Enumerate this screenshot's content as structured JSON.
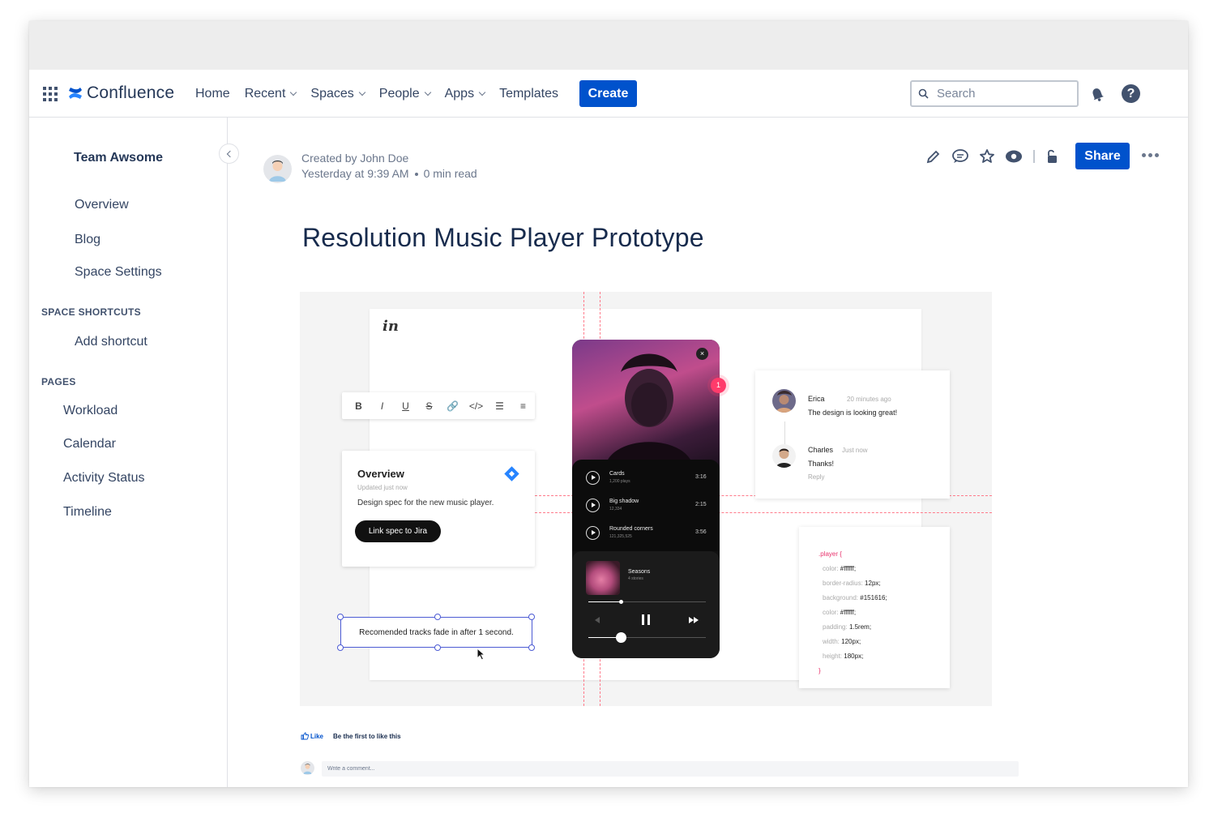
{
  "app": {
    "name": "Confluence",
    "brand_color": "#0052cc"
  },
  "topnav": {
    "items": [
      {
        "label": "Home",
        "has_dropdown": false
      },
      {
        "label": "Recent",
        "has_dropdown": true
      },
      {
        "label": "Spaces",
        "has_dropdown": true
      },
      {
        "label": "People",
        "has_dropdown": true
      },
      {
        "label": "Apps",
        "has_dropdown": true
      },
      {
        "label": "Templates",
        "has_dropdown": false
      }
    ],
    "create_label": "Create",
    "search_placeholder": "Search",
    "help_glyph": "?"
  },
  "sidebar": {
    "space_name": "Team Awsome",
    "items": [
      "Overview",
      "Blog",
      "Space Settings"
    ],
    "shortcuts_heading": "SPACE SHORTCUTS",
    "add_shortcut": "Add shortcut",
    "pages_heading": "PAGES",
    "pages": [
      "Workload",
      "Calendar",
      "Activity Status",
      "Timeline"
    ]
  },
  "page": {
    "created_by": "Created by John Doe",
    "timestamp": "Yesterday at 9:39 AM",
    "read_time": "0 min read",
    "share_label": "Share",
    "title": "Resolution Music Player Prototype"
  },
  "prototype": {
    "logo": "in",
    "rte_buttons": [
      "B",
      "I",
      "U",
      "S",
      "🔗",
      "</>",
      "☰",
      "≡"
    ],
    "overview": {
      "title": "Overview",
      "updated": "Updated just now",
      "description": "Design spec for the new music player.",
      "button": "Link spec to Jira"
    },
    "note": "Recomended tracks fade in after 1 second.",
    "close_glyph": "×",
    "tracks": [
      {
        "name": "Cards",
        "plays": "1,200 plays",
        "duration": "3:16"
      },
      {
        "name": "Big shadow",
        "plays": "12,334",
        "duration": "2:15"
      },
      {
        "name": "Rounded corners",
        "plays": "121,325,525",
        "duration": "3:56"
      }
    ],
    "now_playing": {
      "name": "Seasons",
      "sub": "4 stories"
    },
    "badge_count": "1",
    "comments": [
      {
        "name": "Erica",
        "time": "20 minutes ago",
        "text": "The design is looking great!"
      },
      {
        "name": "Charles",
        "time": "Just now",
        "text": "Thanks!",
        "reply": "Reply"
      }
    ],
    "code": {
      "selector": ".player {",
      "lines": [
        {
          "prop": "color:",
          "value": "#ffffff;"
        },
        {
          "prop": "border-radius:",
          "value": "12px;"
        },
        {
          "prop": "background:",
          "value": "#151616;"
        },
        {
          "prop": "color:",
          "value": "#ffffff;"
        },
        {
          "prop": "padding:",
          "value": "1.5rem;"
        },
        {
          "prop": "width:",
          "value": "120px;"
        },
        {
          "prop": "height:",
          "value": "180px;"
        }
      ],
      "close": "}"
    }
  },
  "footer": {
    "like_label": "Like",
    "like_note": "Be the first to like this",
    "comment_placeholder": "Write a comment..."
  }
}
